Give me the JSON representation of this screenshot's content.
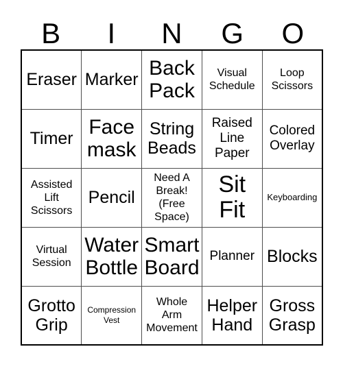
{
  "card": {
    "type": "bingo-card",
    "header_letters": [
      "B",
      "I",
      "N",
      "G",
      "O"
    ],
    "grid_size": "5x5",
    "free_space_index": {
      "row": 2,
      "col": 2
    },
    "colors": {
      "background": "#ffffff",
      "text": "#000000",
      "outer_border": "#000000",
      "inner_border": "#4d4d4d"
    },
    "rows": [
      [
        {
          "text": "Eraser",
          "size": "md"
        },
        {
          "text": "Marker",
          "size": "md"
        },
        {
          "text": "Back\nPack",
          "size": "lg"
        },
        {
          "text": "Visual\nSchedule",
          "size": "xs"
        },
        {
          "text": "Loop\nScissors",
          "size": "xs"
        }
      ],
      [
        {
          "text": "Timer",
          "size": "md"
        },
        {
          "text": "Face\nmask",
          "size": "lg"
        },
        {
          "text": "String\nBeads",
          "size": "md"
        },
        {
          "text": "Raised\nLine\nPaper",
          "size": "sm"
        },
        {
          "text": "Colored\nOverlay",
          "size": "sm"
        }
      ],
      [
        {
          "text": "Assisted\nLift\nScissors",
          "size": "xs"
        },
        {
          "text": "Pencil",
          "size": "md"
        },
        {
          "text": "Need A\nBreak!\n(Free\nSpace)",
          "size": "xs"
        },
        {
          "text": "Sit\nFit",
          "size": "xl"
        },
        {
          "text": "Keyboarding",
          "size": "xxs"
        }
      ],
      [
        {
          "text": "Virtual\nSession",
          "size": "xs"
        },
        {
          "text": "Water\nBottle",
          "size": "lg"
        },
        {
          "text": "Smart\nBoard",
          "size": "lg"
        },
        {
          "text": "Planner",
          "size": "sm"
        },
        {
          "text": "Blocks",
          "size": "md"
        }
      ],
      [
        {
          "text": "Grotto\nGrip",
          "size": "md"
        },
        {
          "text": "Compression\nVest",
          "size": "tiny"
        },
        {
          "text": "Whole\nArm\nMovement",
          "size": "xs"
        },
        {
          "text": "Helper\nHand",
          "size": "md"
        },
        {
          "text": "Gross\nGrasp",
          "size": "md"
        }
      ]
    ]
  }
}
